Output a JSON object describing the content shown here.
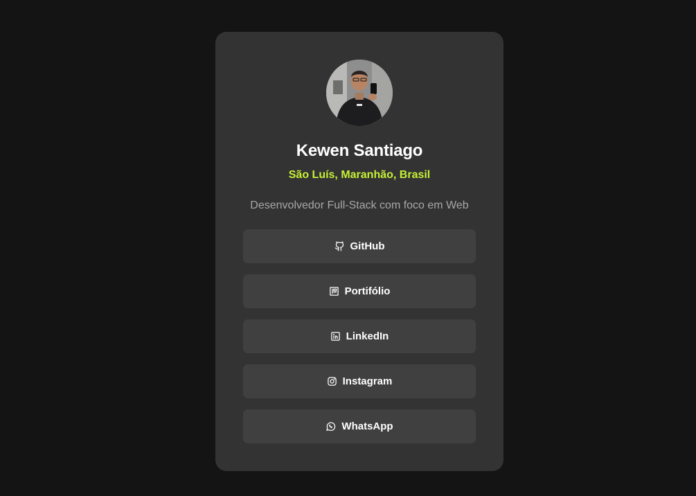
{
  "profile": {
    "name": "Kewen Santiago",
    "location": "São Luís, Maranhão, Brasil",
    "bio": "Desenvolvedor Full-Stack com foco em Web"
  },
  "links": [
    {
      "label": "GitHub",
      "icon": "github-icon"
    },
    {
      "label": "Portifólio",
      "icon": "newspaper-icon"
    },
    {
      "label": "LinkedIn",
      "icon": "linkedin-icon"
    },
    {
      "label": "Instagram",
      "icon": "instagram-icon"
    },
    {
      "label": "WhatsApp",
      "icon": "whatsapp-icon"
    }
  ],
  "colors": {
    "background": "#141414",
    "card": "#333333",
    "button": "#404040",
    "accent": "#c6f135",
    "text": "#ffffff",
    "muted": "#a8a8a8"
  }
}
